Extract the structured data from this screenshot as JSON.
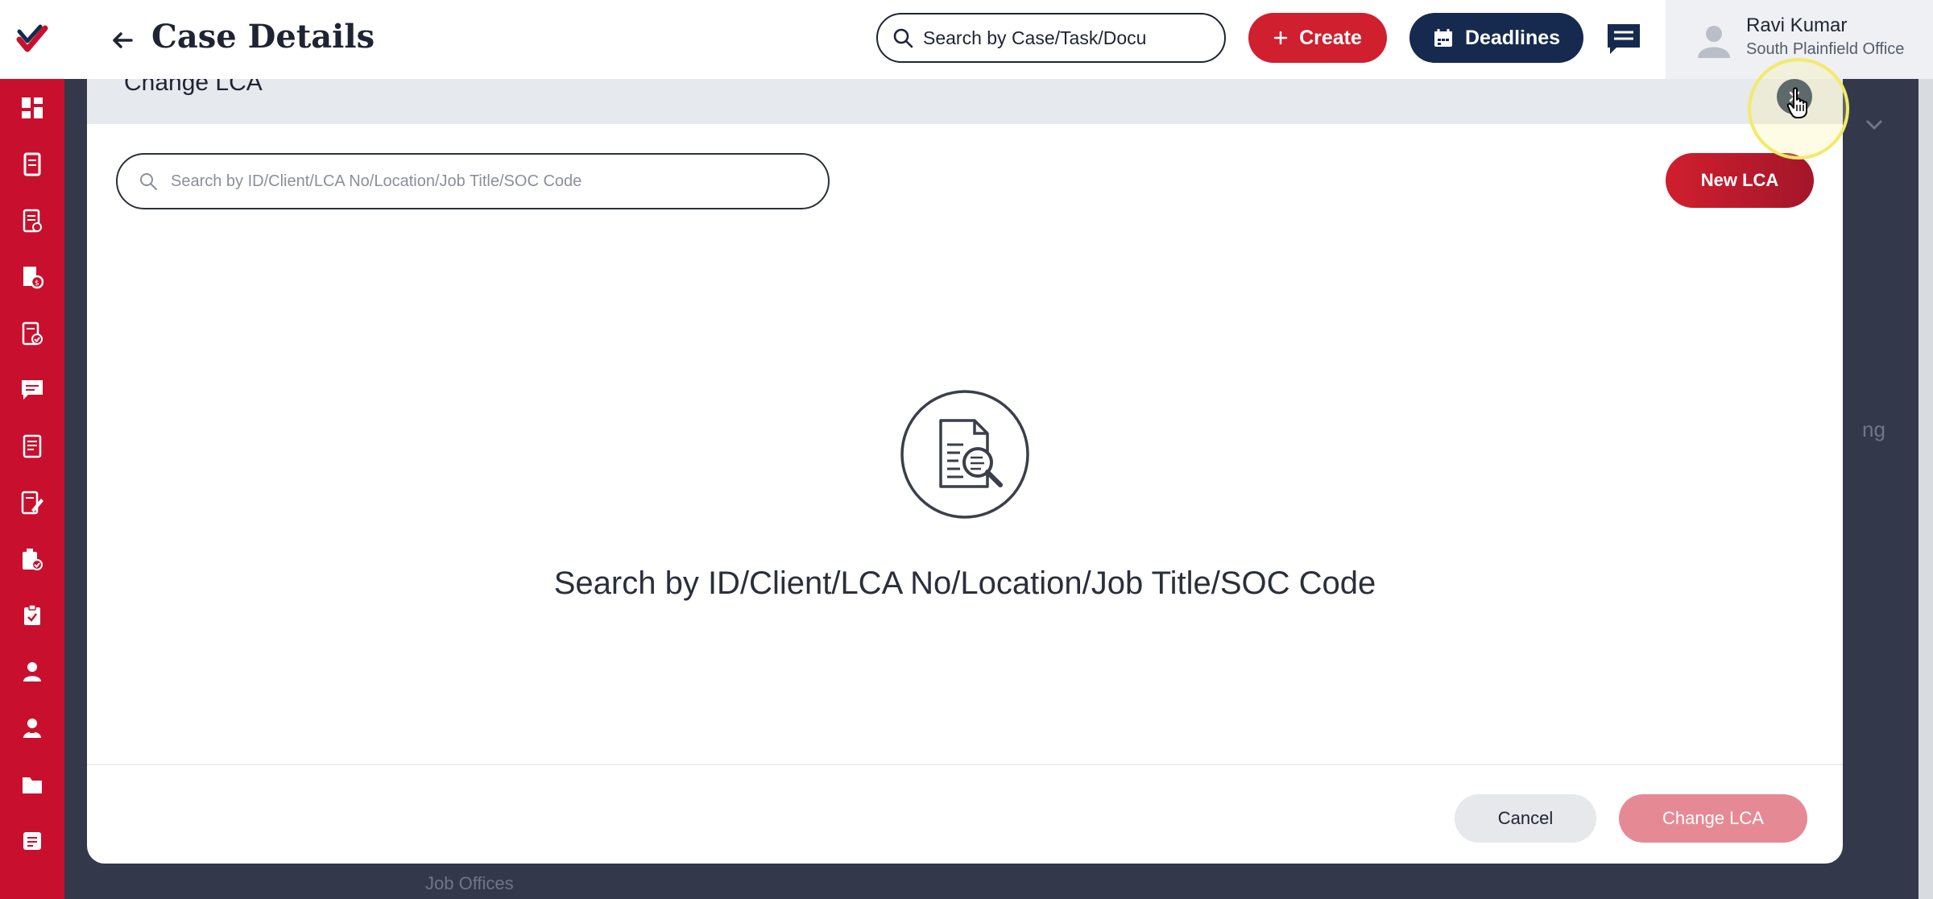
{
  "header": {
    "title": "Case Details",
    "search_text": "Search by Case/Task/Docu",
    "create_label": "Create",
    "deadlines_label": "Deadlines",
    "user_name": "Ravi Kumar",
    "user_office": "South Plainfield Office"
  },
  "modal": {
    "title": "Change LCA",
    "search_placeholder": "Search by ID/Client/LCA No/Location/Job Title/SOC Code",
    "new_lca_label": "New LCA",
    "empty_message": "Search by ID/Client/LCA No/Location/Job Title/SOC Code",
    "cancel_label": "Cancel",
    "change_label": "Change LCA"
  },
  "background": {
    "partial_label": "Job Offices",
    "partial_side": "ng"
  },
  "colors": {
    "sidebar": "#c8102e",
    "create": "#d01f2e",
    "deadlines": "#162a4f",
    "backdrop": "#33394a"
  },
  "sidebar": {
    "icons": [
      "dashboard-icon",
      "cases-icon",
      "forms-icon",
      "billing-icon",
      "approvals-icon",
      "messages-icon",
      "docs-icon",
      "notes-icon",
      "reports-icon",
      "tasks-icon",
      "contacts-icon",
      "users-icon",
      "files-icon",
      "settings-icon"
    ]
  }
}
